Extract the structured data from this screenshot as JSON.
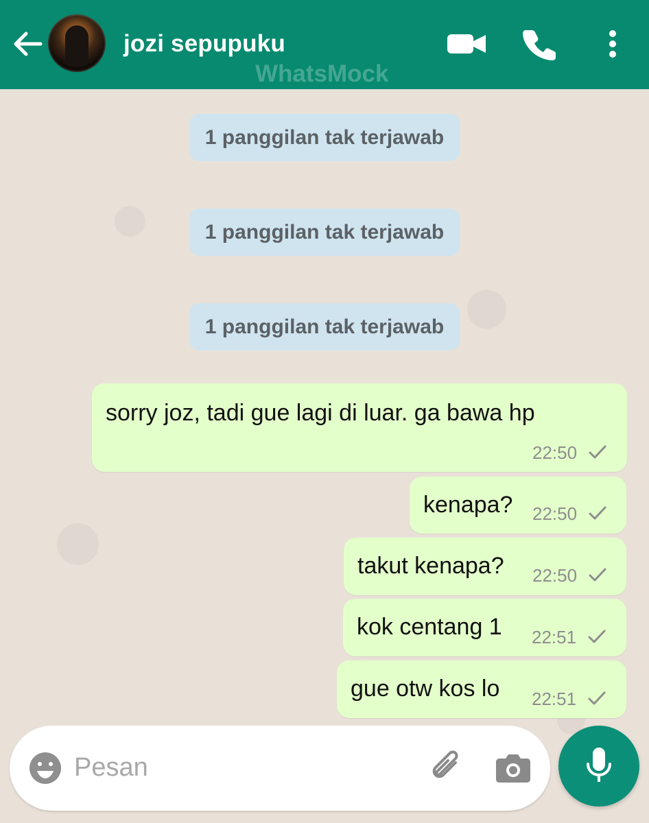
{
  "header": {
    "contact_name": "jozi sepupuku",
    "watermark": "WhatsMock",
    "icons": {
      "back": "back-arrow-icon",
      "video": "video-call-icon",
      "phone": "voice-call-icon",
      "menu": "more-options-icon"
    }
  },
  "chat": {
    "missed_calls": [
      {
        "label": "1 panggilan tak terjawab"
      },
      {
        "label": "1 panggilan tak terjawab"
      },
      {
        "label": "1 panggilan tak terjawab"
      }
    ],
    "messages": [
      {
        "text": "sorry joz, tadi gue lagi di luar. ga bawa hp",
        "time": "22:50",
        "status": "sent"
      },
      {
        "text": "kenapa?",
        "time": "22:50",
        "status": "sent"
      },
      {
        "text": "takut kenapa?",
        "time": "22:50",
        "status": "sent"
      },
      {
        "text": "kok centang 1",
        "time": "22:51",
        "status": "sent"
      },
      {
        "text": "gue otw kos lo",
        "time": "22:51",
        "status": "sent"
      }
    ]
  },
  "composer": {
    "placeholder": "Pesan",
    "icons": {
      "emoji": "emoji-icon",
      "attach": "paperclip-icon",
      "camera": "camera-icon",
      "mic": "microphone-icon"
    }
  },
  "colors": {
    "header": "#078a6f",
    "bubble_out": "#e3ffca",
    "system_bubble": "#cfe4ef",
    "chat_bg": "#e9e1d8",
    "mic_button": "#0c8f78"
  }
}
